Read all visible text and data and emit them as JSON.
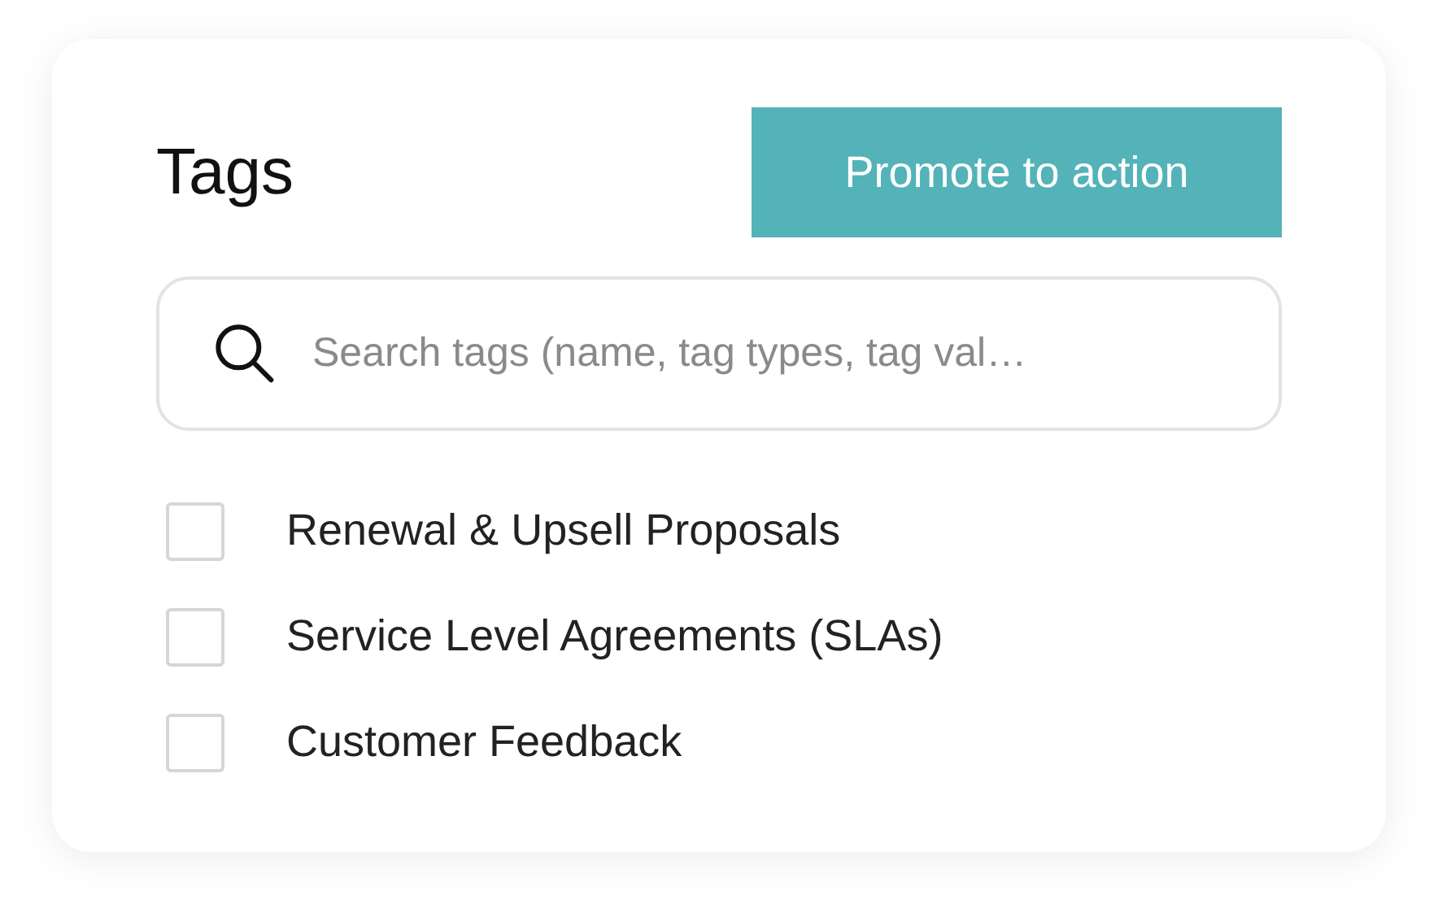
{
  "title": "Tags",
  "action_button": "Promote to action",
  "search": {
    "placeholder": "Search tags (name, tag types, tag val…"
  },
  "tags": [
    {
      "label": "Renewal & Upsell Proposals",
      "checked": false
    },
    {
      "label": "Service Level Agreements (SLAs)",
      "checked": false
    },
    {
      "label": "Customer Feedback",
      "checked": false
    }
  ]
}
